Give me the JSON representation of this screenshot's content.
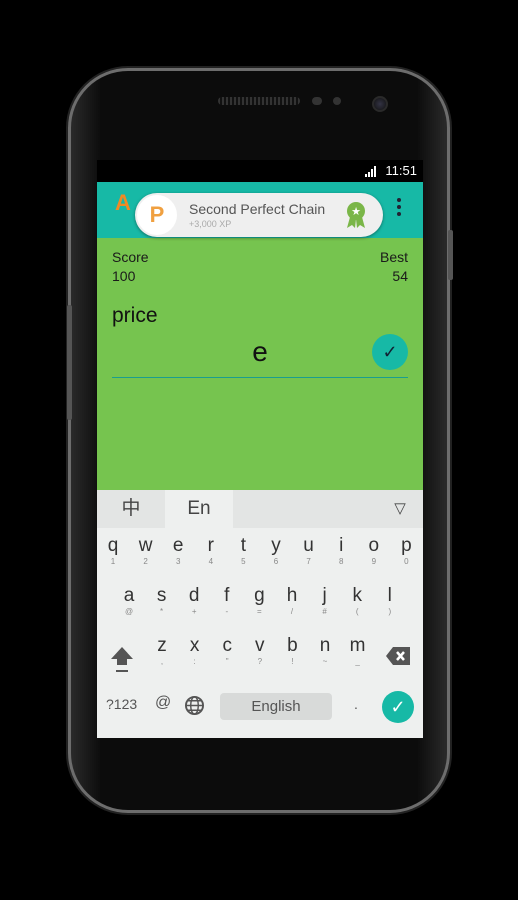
{
  "status": {
    "time": "11:51"
  },
  "header": {
    "logo": "A"
  },
  "notification": {
    "title": "Second Perfect Chain",
    "subtitle": "+3,000 XP"
  },
  "game": {
    "score_label": "Score",
    "score": "100",
    "best_label": "Best",
    "best": "54",
    "word": "price",
    "input_value": "e"
  },
  "keyboard": {
    "tabs": [
      "中",
      "En"
    ],
    "rows": [
      [
        [
          "q",
          "1"
        ],
        [
          "w",
          "2"
        ],
        [
          "e",
          "3"
        ],
        [
          "r",
          "4"
        ],
        [
          "t",
          "5"
        ],
        [
          "y",
          "6"
        ],
        [
          "u",
          "7"
        ],
        [
          "i",
          "8"
        ],
        [
          "o",
          "9"
        ],
        [
          "p",
          "0"
        ]
      ],
      [
        [
          "a",
          "@"
        ],
        [
          "s",
          "*"
        ],
        [
          "d",
          "+"
        ],
        [
          "f",
          "-"
        ],
        [
          "g",
          "="
        ],
        [
          "h",
          "/"
        ],
        [
          "j",
          "#"
        ],
        [
          "k",
          "("
        ],
        [
          "l",
          ")"
        ]
      ],
      [
        [
          "z",
          ","
        ],
        [
          "x",
          ":"
        ],
        [
          "c",
          "\""
        ],
        [
          "v",
          "?"
        ],
        [
          "b",
          "!"
        ],
        [
          "n",
          "~"
        ],
        [
          "m",
          "_"
        ]
      ]
    ],
    "symbols_label": "?123",
    "at_label": "@",
    "space_label": "English",
    "period_label": "."
  },
  "colors": {
    "accent": "#17b9a6",
    "background": "#76c44f"
  }
}
